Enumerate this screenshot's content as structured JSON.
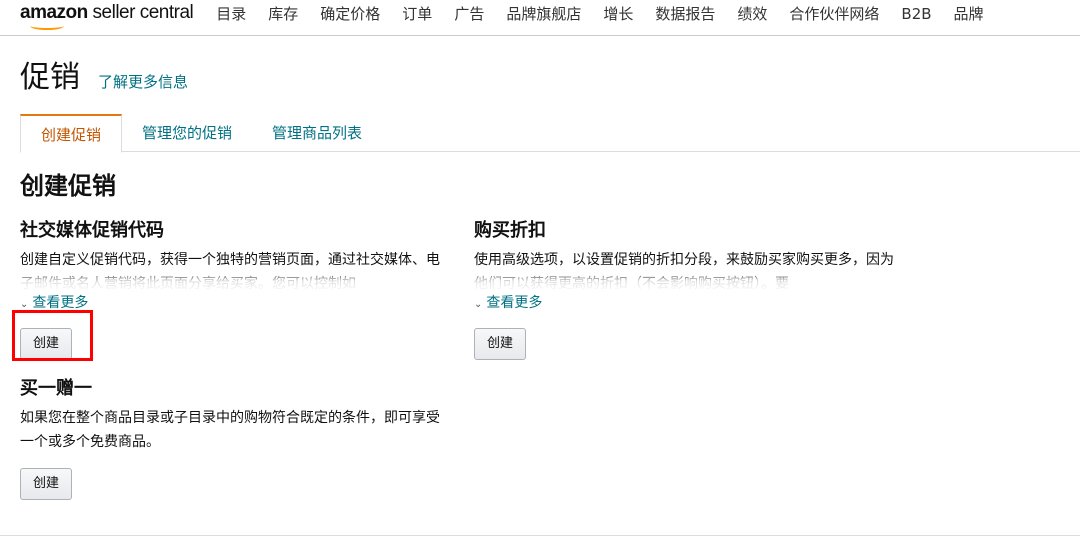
{
  "header": {
    "logo": {
      "brand": "amazon",
      "product": " seller central"
    },
    "nav": [
      "目录",
      "库存",
      "确定价格",
      "订单",
      "广告",
      "品牌旗舰店",
      "增长",
      "数据报告",
      "绩效",
      "合作伙伴网络",
      "B2B",
      "品牌"
    ]
  },
  "page": {
    "title": "促销",
    "learn_more": "了解更多信息"
  },
  "tabs": [
    {
      "label": "创建促销",
      "active": true
    },
    {
      "label": "管理您的促销"
    },
    {
      "label": "管理商品列表"
    }
  ],
  "section_title": "创建促销",
  "cards": [
    {
      "title": "社交媒体促销代码",
      "desc": "创建自定义促销代码，获得一个独特的营销页面，通过社交媒体、电子邮件或名人营销将此页面分享给买家。您可以控制如",
      "more": "查看更多",
      "button": "创建"
    },
    {
      "title": "购买折扣",
      "desc": "使用高级选项，以设置促销的折扣分段，来鼓励买家购买更多，因为他们可以获得更高的折扣（不会影响购买按钮）。要",
      "more": "查看更多",
      "button": "创建"
    },
    {
      "title": "买一赠一",
      "desc": "如果您在整个商品目录或子目录中的购物符合既定的条件，即可享受一个或多个免费商品。",
      "button": "创建"
    }
  ],
  "colors": {
    "link": "#007185",
    "active_tab": "#c45500",
    "highlight": "#ff0000"
  }
}
